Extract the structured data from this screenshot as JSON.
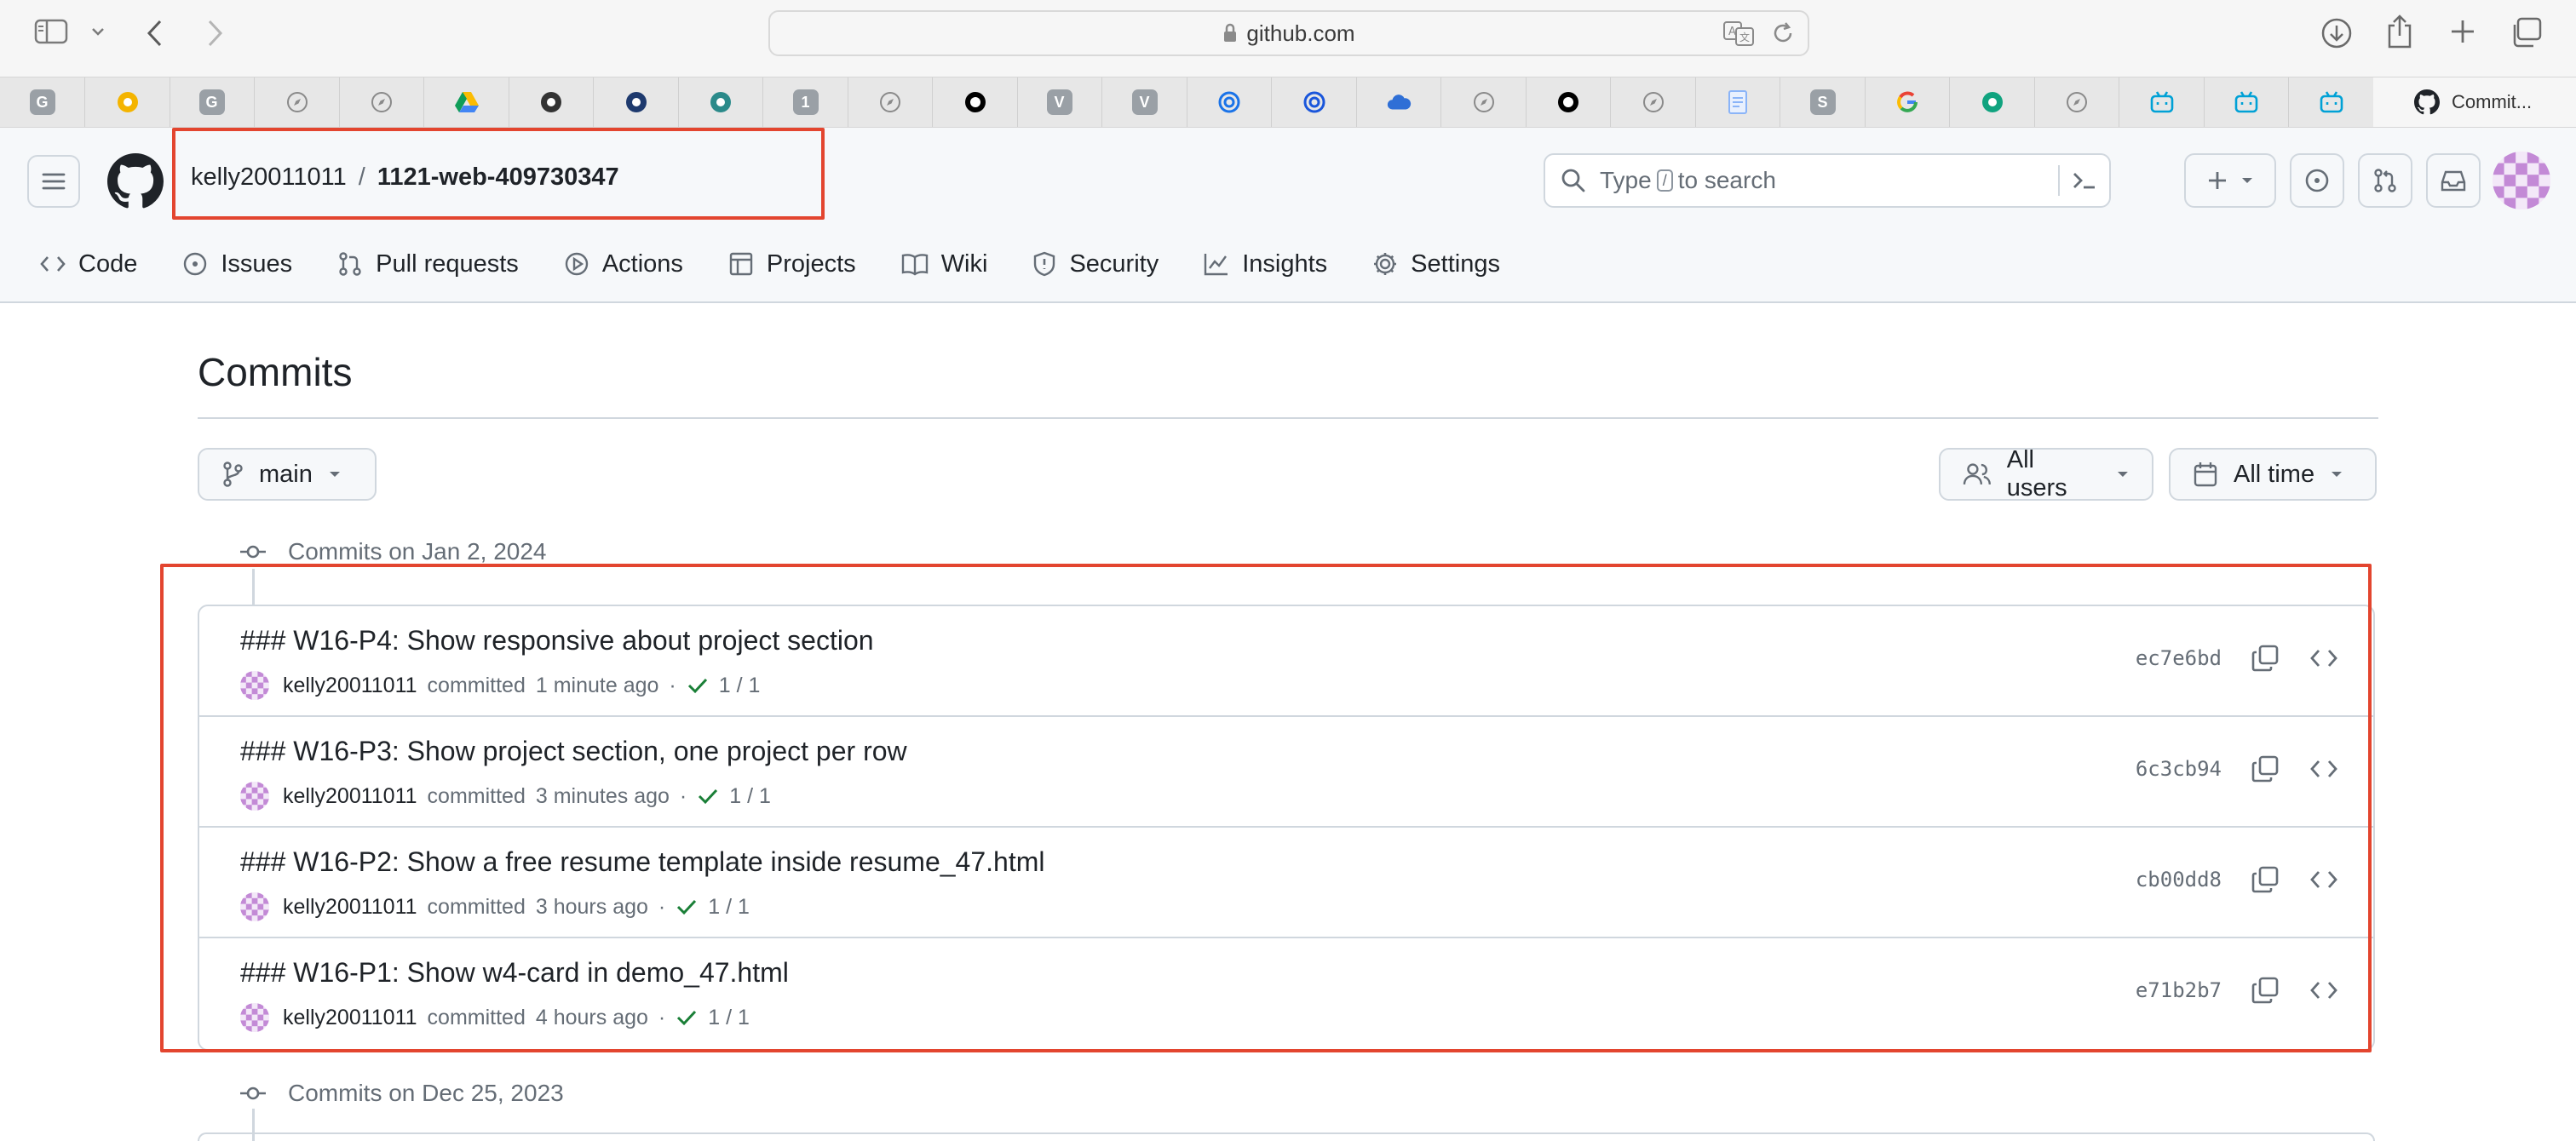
{
  "browser": {
    "url": "github.com",
    "active_tab_title": "Commit..."
  },
  "favorites": [
    {
      "icon": "g-letter-icon",
      "letter": "G",
      "color": "#9aa0a6"
    },
    {
      "icon": "slides-icon",
      "letter": "",
      "color": "#f4b400"
    },
    {
      "icon": "g-letter-icon",
      "letter": "G",
      "color": "#9aa0a6"
    },
    {
      "icon": "compass-icon",
      "letter": "",
      "color": ""
    },
    {
      "icon": "compass-icon",
      "letter": "",
      "color": ""
    },
    {
      "icon": "google-drive-icon",
      "letter": "",
      "color": ""
    },
    {
      "icon": "seal-icon",
      "letter": "",
      "color": "#333333"
    },
    {
      "icon": "seal-icon",
      "letter": "",
      "color": "#1e3a6e"
    },
    {
      "icon": "bird-icon",
      "letter": "",
      "color": "#2b8a8a"
    },
    {
      "icon": "number-one-icon",
      "letter": "1",
      "color": "#9aa0a6"
    },
    {
      "icon": "compass-icon",
      "letter": "",
      "color": ""
    },
    {
      "icon": "github-icon",
      "letter": "",
      "color": "#000000"
    },
    {
      "icon": "v-letter-icon",
      "letter": "V",
      "color": "#9aa0a6"
    },
    {
      "icon": "v-letter-icon",
      "letter": "V",
      "color": "#9aa0a6"
    },
    {
      "icon": "target-icon",
      "letter": "",
      "color": "#1a73e8"
    },
    {
      "icon": "ring-icon",
      "letter": "",
      "color": "#1a56db"
    },
    {
      "icon": "cloud-icon",
      "letter": "",
      "color": "#2f6fd6"
    },
    {
      "icon": "compass-icon",
      "letter": "",
      "color": ""
    },
    {
      "icon": "codepen-icon",
      "letter": "",
      "color": "#000000"
    },
    {
      "icon": "compass-icon",
      "letter": "",
      "color": ""
    },
    {
      "icon": "document-icon",
      "letter": "",
      "color": "#8ab4f8"
    },
    {
      "icon": "s-letter-icon",
      "letter": "S",
      "color": "#9aa0a6"
    },
    {
      "icon": "google-icon",
      "letter": "",
      "color": ""
    },
    {
      "icon": "openai-icon",
      "letter": "",
      "color": "#10a37f"
    },
    {
      "icon": "compass-icon",
      "letter": "",
      "color": ""
    },
    {
      "icon": "bilibili-icon",
      "letter": "",
      "color": "#00a1d6"
    },
    {
      "icon": "bilibili-icon",
      "letter": "",
      "color": "#00a1d6"
    },
    {
      "icon": "bilibili-icon",
      "letter": "",
      "color": "#00a1d6"
    }
  ],
  "repo": {
    "owner": "kelly20011011",
    "separator": "/",
    "name": "1121-web-409730347"
  },
  "search": {
    "placeholder_before": "Type",
    "slash_key": "/",
    "placeholder_after": "to search"
  },
  "nav": {
    "code": "Code",
    "issues": "Issues",
    "pull_requests": "Pull requests",
    "actions": "Actions",
    "projects": "Projects",
    "wiki": "Wiki",
    "security": "Security",
    "insights": "Insights",
    "settings": "Settings"
  },
  "page": {
    "title": "Commits",
    "branch": "main",
    "users_filter": "All users",
    "time_filter": "All time"
  },
  "groups": [
    {
      "heading": "Commits on Jan 2, 2024"
    },
    {
      "heading": "Commits on Dec 25, 2023"
    }
  ],
  "commits": [
    {
      "title": "### W16-P4: Show responsive about project section",
      "author": "kelly20011011",
      "verb": "committed",
      "time": "1 minute ago",
      "checks": "1 / 1",
      "sha": "ec7e6bd"
    },
    {
      "title": "### W16-P3: Show project section, one project per row",
      "author": "kelly20011011",
      "verb": "committed",
      "time": "3 minutes ago",
      "checks": "1 / 1",
      "sha": "6c3cb94"
    },
    {
      "title": "### W16-P2: Show a free resume template inside resume_47.html",
      "author": "kelly20011011",
      "verb": "committed",
      "time": "3 hours ago",
      "checks": "1 / 1",
      "sha": "cb00dd8"
    },
    {
      "title": "### W16-P1: Show w4-card in demo_47.html",
      "author": "kelly20011011",
      "verb": "committed",
      "time": "4 hours ago",
      "checks": "1 / 1",
      "sha": "e71b2b7"
    }
  ],
  "colors": {
    "highlight": "#e3452f",
    "check_green": "#1a7f37",
    "muted": "#656d76",
    "border": "#d0d7de"
  }
}
